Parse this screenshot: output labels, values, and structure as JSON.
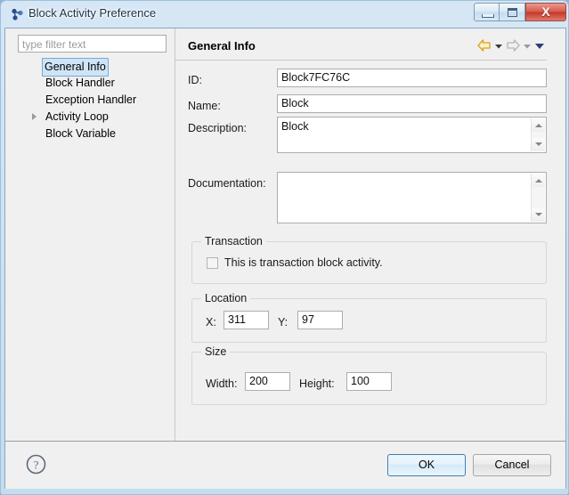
{
  "window": {
    "title": "Block Activity Preference",
    "icon": "block-activity-icon",
    "controls": {
      "minimize": "minimize-button",
      "maximize": "maximize-button",
      "close_label": "X"
    }
  },
  "sidebar": {
    "filter": {
      "placeholder": "type filter text",
      "value": ""
    },
    "items": [
      {
        "label": "General Info",
        "selected": true,
        "expandable": false
      },
      {
        "label": "Block Handler",
        "selected": false,
        "expandable": false
      },
      {
        "label": "Exception Handler",
        "selected": false,
        "expandable": false
      },
      {
        "label": "Activity Loop",
        "selected": false,
        "expandable": true
      },
      {
        "label": "Block Variable",
        "selected": false,
        "expandable": false
      }
    ]
  },
  "page": {
    "title": "General Info",
    "nav": {
      "back_icon": "back-arrow-icon",
      "back_menu_icon": "chevron-down-icon",
      "forward_icon": "forward-arrow-icon",
      "forward_menu_icon": "chevron-down-icon",
      "menu_icon": "chevron-down-icon"
    },
    "fields": {
      "id": {
        "label": "ID:",
        "value": "Block7FC76C"
      },
      "name": {
        "label": "Name:",
        "value": "Block"
      },
      "description": {
        "label": "Description:",
        "value": "Block"
      },
      "documentation": {
        "label": "Documentation:",
        "value": ""
      }
    },
    "transaction": {
      "title": "Transaction",
      "checkbox_label": "This is transaction block activity.",
      "checked": false
    },
    "location": {
      "title": "Location",
      "x": {
        "label": "X:",
        "value": "311"
      },
      "y": {
        "label": "Y:",
        "value": "97"
      }
    },
    "size": {
      "title": "Size",
      "width": {
        "label": "Width:",
        "value": "200"
      },
      "height": {
        "label": "Height:",
        "value": "100"
      }
    }
  },
  "footer": {
    "help_icon": "help-icon",
    "ok_label": "OK",
    "cancel_label": "Cancel"
  },
  "colors": {
    "accent": "#3c7fb1",
    "selection": "#cfe4f7",
    "back_arrow": "#e8a317",
    "close_button": "#c33828"
  }
}
